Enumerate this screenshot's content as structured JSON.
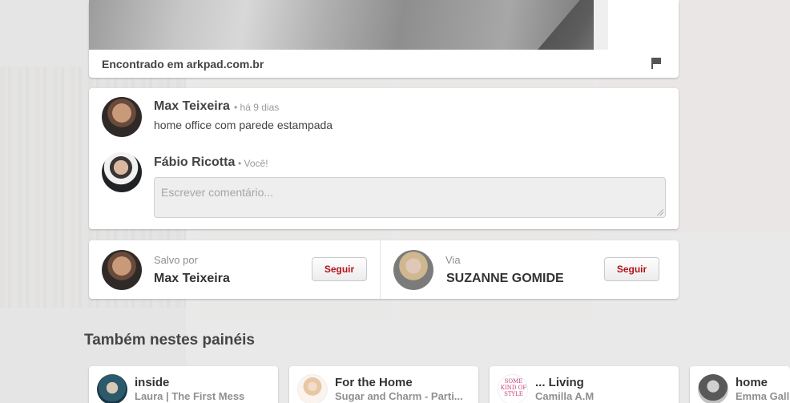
{
  "pin": {
    "source_text": "Encontrado em arkpad.com.br"
  },
  "comments": [
    {
      "author": "Max Teixeira",
      "meta": "• há 9 dias",
      "text": "home office com parede estampada"
    },
    {
      "author": "Fábio Ricotta",
      "meta": "• Você!"
    }
  ],
  "comment_input": {
    "placeholder": "Escrever comentário..."
  },
  "saved_by": {
    "label": "Salvo por",
    "name": "Max Teixeira",
    "follow": "Seguir"
  },
  "via": {
    "label": "Via",
    "name": "SUZANNE GOMIDE",
    "follow": "Seguir"
  },
  "boards_section": {
    "title": "Também nestes painéis",
    "boards": [
      {
        "title": "inside",
        "owner": "Laura | The First Mess"
      },
      {
        "title": "For the Home",
        "owner": "Sugar and Charm - Parti..."
      },
      {
        "title": "... Living",
        "owner": "Camilla A.M"
      },
      {
        "title": "home",
        "owner": "Emma Gall"
      }
    ]
  },
  "colors": {
    "follow_text": "#b5121b",
    "background": "#e9e9e9"
  },
  "icons": {
    "flag": "flag-icon"
  }
}
